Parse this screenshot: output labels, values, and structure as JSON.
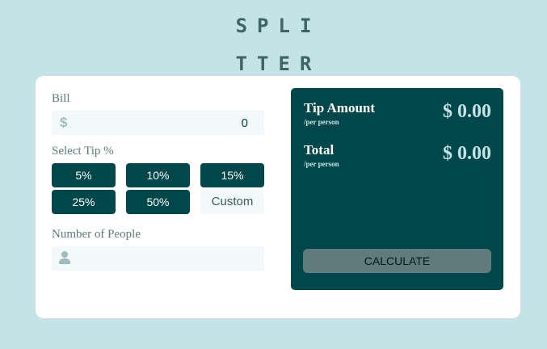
{
  "logo": {
    "line1": "SPLI",
    "line2": "TTER"
  },
  "bill": {
    "label": "Bill",
    "currency_icon": "$",
    "value": "0"
  },
  "tip": {
    "label": "Select Tip %",
    "options": [
      "5%",
      "10%",
      "15%",
      "25%",
      "50%"
    ],
    "custom_label": "Custom"
  },
  "people": {
    "label": "Number of People",
    "icon": "person-icon",
    "value": ""
  },
  "results": {
    "tip_amount": {
      "title": "Tip Amount",
      "sub": "/per person",
      "value": "$ 0.00"
    },
    "total": {
      "title": "Total",
      "sub": "/per person",
      "value": "$ 0.00"
    },
    "calculate_label": "CALCULATE"
  },
  "colors": {
    "background": "#c5e3e6",
    "dark": "#00474b",
    "button_muted": "#5f7b7d"
  }
}
